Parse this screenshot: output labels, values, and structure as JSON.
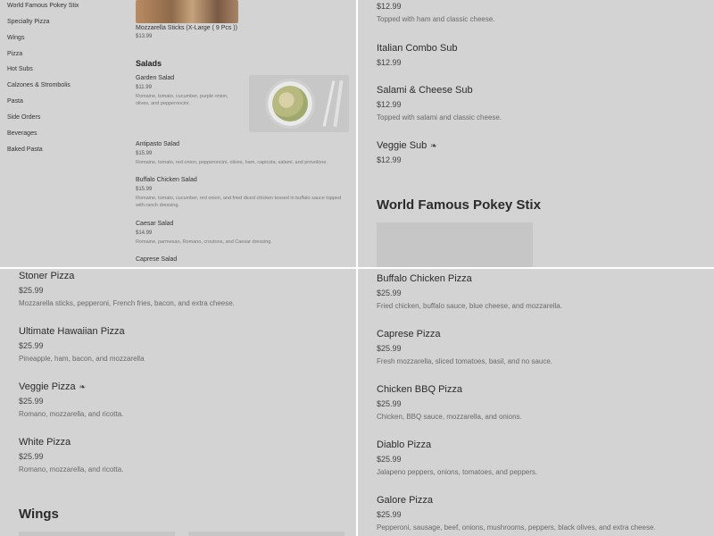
{
  "sidebar": {
    "items": [
      {
        "label": "World Famous Pokey Stix"
      },
      {
        "label": "Specialty Pizza"
      },
      {
        "label": "Wings"
      },
      {
        "label": "Pizza"
      },
      {
        "label": "Hot Subs"
      },
      {
        "label": "Calzones & Strombolis"
      },
      {
        "label": "Pasta"
      },
      {
        "label": "Side Orders"
      },
      {
        "label": "Beverages"
      },
      {
        "label": "Baked Pasta"
      }
    ]
  },
  "q1": {
    "top_item": {
      "name": "Mozzarella Sticks (X-Large ( 9 Pcs ))",
      "price": "$13.99"
    },
    "section_title": "Salads",
    "items": [
      {
        "name": "Garden Salad",
        "price": "$11.99",
        "desc": "Romaine, tomato, cucumber, purple onion, olives, and pepperoncini."
      },
      {
        "name": "Antipasto Salad",
        "price": "$15.99",
        "desc": "Romaine, tomato, red onion, pepperoncini, olives, ham, capicola, salami, and provolone."
      },
      {
        "name": "Buffalo Chicken Salad",
        "price": "$15.99",
        "desc": "Romaine, tomato, cucumber, red onion, and fried diced chicken tossed in buffalo sauce topped with ranch dressing."
      },
      {
        "name": "Caesar Salad",
        "price": "$14.99",
        "desc": "Romaine, parmesan, Romano, croutons, and Caesar dressing."
      },
      {
        "name": "Caprese Salad"
      }
    ]
  },
  "q2": {
    "items": [
      {
        "price": "$12.99",
        "desc": "Topped with ham and classic cheese."
      },
      {
        "name": "Italian Combo Sub",
        "price": "$12.99"
      },
      {
        "name": "Salami & Cheese Sub",
        "price": "$12.99",
        "desc": "Topped with salami and classic cheese."
      },
      {
        "name": "Veggie Sub",
        "price": "$12.99",
        "icon": "leaf-icon"
      }
    ],
    "section_title": "World Famous Pokey Stix"
  },
  "q3": {
    "items": [
      {
        "name": "Stoner Pizza",
        "price": "$25.99",
        "desc": "Mozzarella sticks, pepperoni, French fries, bacon, and extra cheese."
      },
      {
        "name": "Ultimate Hawaiian Pizza",
        "price": "$25.99",
        "desc": "Pineapple, ham, bacon, and mozzarella"
      },
      {
        "name": "Veggie Pizza",
        "price": "$25.99",
        "desc": "Romano, mozzarella, and ricotta.",
        "icon": "leaf-icon"
      },
      {
        "name": "White Pizza",
        "price": "$25.99",
        "desc": "Romano, mozzarella, and ricotta."
      }
    ],
    "section_title": "Wings"
  },
  "q4": {
    "items": [
      {
        "name": "Buffalo Chicken Pizza",
        "price": "$25.99",
        "desc": "Fried chicken, buffalo sauce, blue cheese, and mozzarella."
      },
      {
        "name": "Caprese Pizza",
        "price": "$25.99",
        "desc": "Fresh mozzarella, sliced tomatoes, basil, and no sauce."
      },
      {
        "name": "Chicken BBQ Pizza",
        "price": "$25.99",
        "desc": "Chicken, BBQ sauce, mozzarella, and onions."
      },
      {
        "name": "Diablo Pizza",
        "price": "$25.99",
        "desc": "Jalapeno peppers, onions, tomatoes, and peppers."
      },
      {
        "name": "Galore Pizza",
        "price": "$25.99",
        "desc": "Pepperoni, sausage, beef, onions, mushrooms, peppers, black olives, and extra cheese."
      }
    ]
  }
}
